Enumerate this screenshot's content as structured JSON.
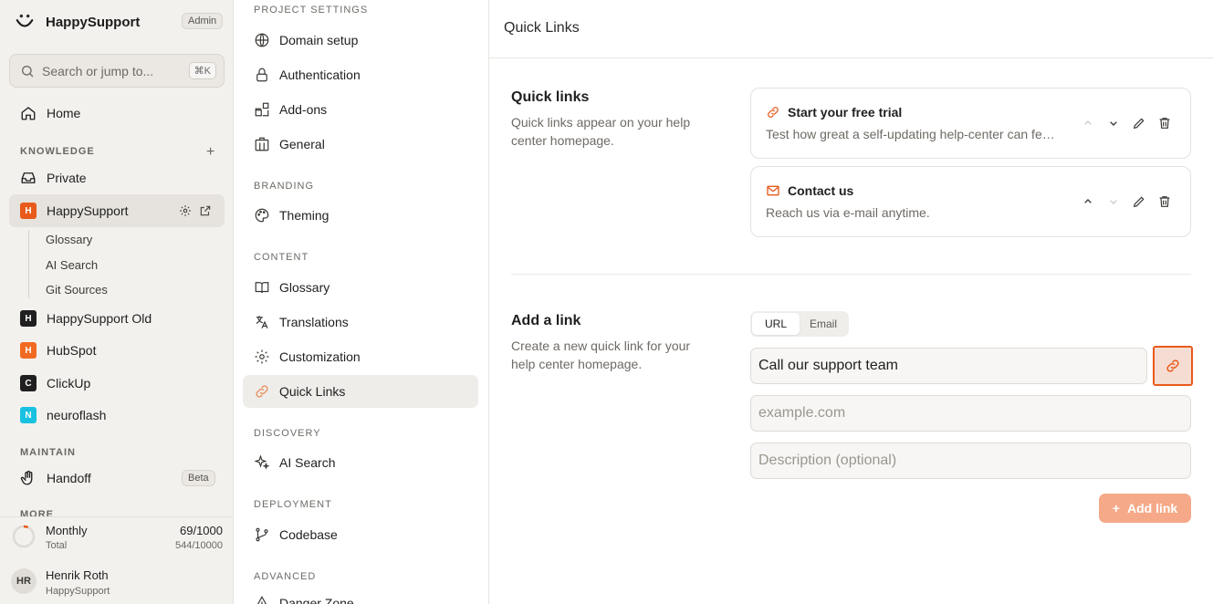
{
  "app": {
    "name": "HappySupport",
    "role_badge": "Admin"
  },
  "search": {
    "placeholder": "Search or jump to...",
    "shortcut": "⌘K"
  },
  "sidebar": {
    "home": "Home",
    "knowledge_label": "KNOWLEDGE",
    "items": {
      "private": "Private",
      "happysupport": "HappySupport",
      "glossary": "Glossary",
      "ai_search": "AI Search",
      "git_sources": "Git Sources",
      "happysupport_old": "HappySupport Old",
      "hubspot": "HubSpot",
      "clickup": "ClickUp",
      "neuroflash": "neuroflash"
    },
    "squares": {
      "happysupport": "H",
      "happysupport_old": "H",
      "hubspot": "H",
      "clickup": "C",
      "neuroflash": "N"
    },
    "maintain_label": "MAINTAIN",
    "handoff": "Handoff",
    "beta_badge": "Beta",
    "more_label": "MORE"
  },
  "usage": {
    "label": "Monthly",
    "sub": "Total",
    "monthly": "69/1000",
    "total": "544/10000",
    "progress": 0.069
  },
  "user": {
    "initials": "HR",
    "name": "Henrik Roth",
    "org": "HappySupport"
  },
  "settings": {
    "project_label": "PROJECT SETTINGS",
    "domain": "Domain setup",
    "auth": "Authentication",
    "addons": "Add-ons",
    "general": "General",
    "branding_label": "BRANDING",
    "theming": "Theming",
    "content_label": "CONTENT",
    "glossary": "Glossary",
    "translations": "Translations",
    "customization": "Customization",
    "quick_links": "Quick Links",
    "discovery_label": "DISCOVERY",
    "ai_search": "AI Search",
    "deployment_label": "DEPLOYMENT",
    "codebase": "Codebase",
    "advanced_label": "ADVANCED",
    "danger": "Danger Zone"
  },
  "main": {
    "page_title": "Quick Links",
    "quick_links_title": "Quick links",
    "quick_links_desc": "Quick links appear on your help center homepage.",
    "links": [
      {
        "title": "Start your free trial",
        "desc": "Test how great a self-updating help-center can feel. Start your free trial now.",
        "icon": "link-icon"
      },
      {
        "title": "Contact us",
        "desc": "Reach us via e-mail anytime.",
        "icon": "mail-icon"
      }
    ],
    "add_title": "Add a link",
    "add_desc": "Create a new quick link for your help center homepage.",
    "tabs": [
      "URL",
      "Email"
    ],
    "title_value": "Call our support team",
    "url_placeholder": "example.com",
    "desc_placeholder": "Description (optional)",
    "add_button": "Add link"
  },
  "colors": {
    "accent": "#e85a1b",
    "hubspot": "#f26a21",
    "neuroflash": "#18c1e0",
    "dark": "#1f1f1f"
  }
}
